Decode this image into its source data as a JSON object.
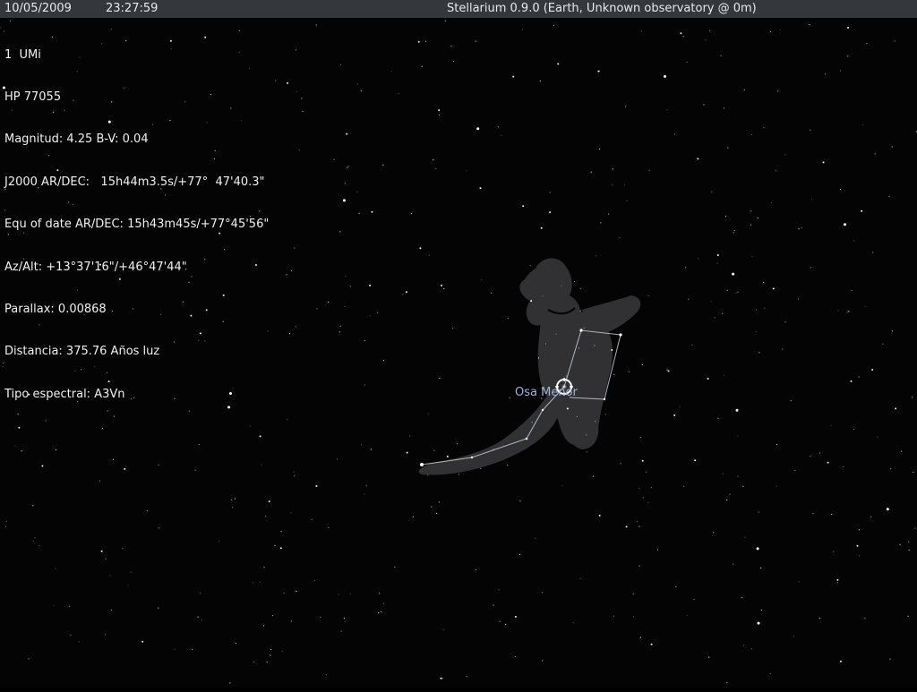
{
  "topbar": {
    "date": "10/05/2009",
    "time": "23:27:59",
    "title": "Stellarium 0.9.0 (Earth, Unknown observatory @ 0m)"
  },
  "object_info": {
    "name": "1  UMi",
    "hip": "HP 77055",
    "magnitude": "Magnitud: 4.25 B-V: 0.04",
    "j2000": "J2000 AR/DEC:   15h44m3.5s/+77°  47'40.3\"",
    "equ_of_date": "Equ of date AR/DEC: 15h43m45s/+77°45'56\"",
    "az_alt": "Az/Alt: +13°37'16\"/+46°47'44\"",
    "parallax": "Parallax: 0.00868",
    "distance": "Distancia: 375.76 Años luz",
    "spectral_type": "Tipo espectral: A3Vn"
  },
  "constellation": {
    "label": "Osa Menor"
  },
  "colors": {
    "sky": "#040405",
    "topbar": "#34383c",
    "text": "#f0f0f0",
    "constellation_line": "#c8d0e0",
    "constellation_label": "#9fb4d6",
    "selection_marker": "#ffffff"
  },
  "icons": {
    "selection_marker": "target-reticle-icon"
  }
}
